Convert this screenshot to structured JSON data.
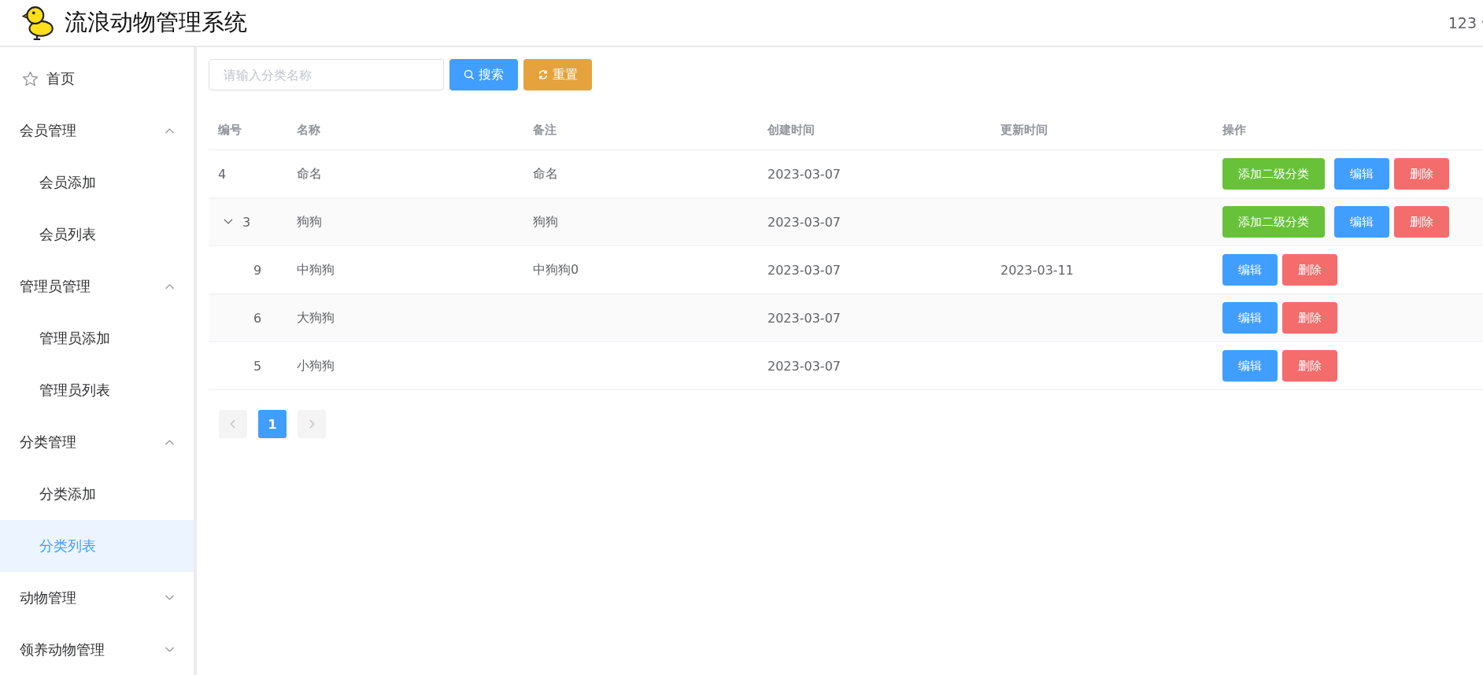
{
  "header": {
    "title": "流浪动物管理系统",
    "user": "123"
  },
  "sidebar": {
    "items": [
      {
        "kind": "link",
        "label": "首页",
        "selected": false
      },
      {
        "kind": "group",
        "label": "会员管理",
        "expanded": true,
        "children": [
          {
            "label": "会员添加",
            "selected": false
          },
          {
            "label": "会员列表",
            "selected": false
          }
        ]
      },
      {
        "kind": "group",
        "label": "管理员管理",
        "expanded": true,
        "children": [
          {
            "label": "管理员添加",
            "selected": false
          },
          {
            "label": "管理员列表",
            "selected": false
          }
        ]
      },
      {
        "kind": "group",
        "label": "分类管理",
        "expanded": true,
        "children": [
          {
            "label": "分类添加",
            "selected": false
          },
          {
            "label": "分类列表",
            "selected": true
          }
        ]
      },
      {
        "kind": "group",
        "label": "动物管理",
        "expanded": false
      },
      {
        "kind": "group",
        "label": "领养动物管理",
        "expanded": false
      }
    ]
  },
  "search": {
    "placeholder": "请输入分类名称",
    "buttons": [
      {
        "kind": "search",
        "label": "搜索"
      },
      {
        "kind": "reset",
        "label": "重置"
      }
    ]
  },
  "table": {
    "columns": [
      "编号",
      "名称",
      "备注",
      "创建时间",
      "更新时间",
      "操作"
    ],
    "rows": [
      {
        "id": "4",
        "name": "命名",
        "note": "命名",
        "created": "2023-03-07",
        "actions": [
          {
            "kind": "add",
            "label": "添加二级分类"
          },
          {
            "kind": "edit",
            "label": "编辑"
          },
          {
            "kind": "delete",
            "label": "删除"
          }
        ]
      },
      {
        "id": "3",
        "name": "狗狗",
        "note": "狗狗",
        "created": "2023-03-07",
        "expanded": true,
        "actions": [
          {
            "kind": "add",
            "label": "添加二级分类"
          },
          {
            "kind": "edit",
            "label": "编辑"
          },
          {
            "kind": "delete",
            "label": "删除"
          }
        ],
        "children": [
          {
            "id": "9",
            "name": "中狗狗",
            "note": "中狗狗0",
            "created": "2023-03-07",
            "updated": "2023-03-11",
            "actions": [
              {
                "kind": "edit",
                "label": "编辑"
              },
              {
                "kind": "delete",
                "label": "删除"
              }
            ]
          },
          {
            "id": "6",
            "name": "大狗狗",
            "created": "2023-03-07",
            "actions": [
              {
                "kind": "edit",
                "label": "编辑"
              },
              {
                "kind": "delete",
                "label": "删除"
              }
            ]
          },
          {
            "id": "5",
            "name": "小狗狗",
            "created": "2023-03-07",
            "actions": [
              {
                "kind": "edit",
                "label": "编辑"
              },
              {
                "kind": "delete",
                "label": "删除"
              }
            ]
          }
        ]
      }
    ]
  },
  "pagination": {
    "pages": [
      {
        "label": "1",
        "selected": true
      }
    ]
  }
}
